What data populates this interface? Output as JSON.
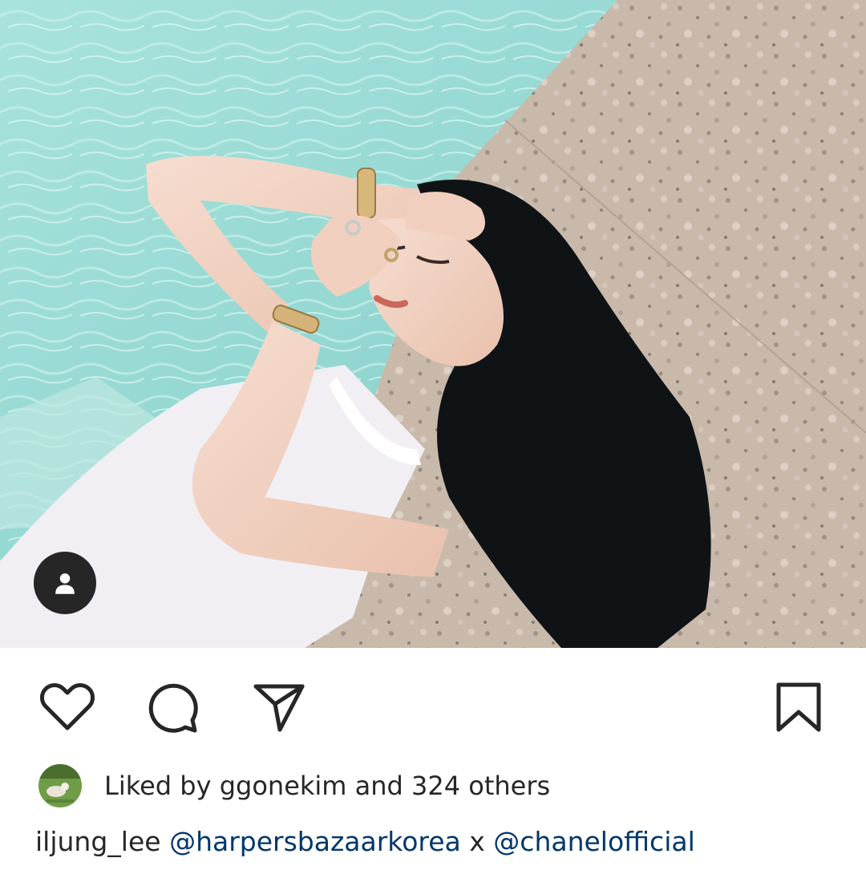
{
  "post": {
    "photo": {
      "alt": "",
      "tag_icon": "person-icon"
    },
    "actions": {
      "like_icon": "heart-icon",
      "comment_icon": "comment-icon",
      "share_icon": "paper-plane-icon",
      "save_icon": "bookmark-icon"
    },
    "likes": {
      "prefix": "Liked by ",
      "user": "ggonekim",
      "suffix": " and 324 others"
    },
    "caption": {
      "author": "iljung_lee",
      "mention_1": "@harpersbazaarkorea",
      "separator": " x ",
      "mention_2": "@chanelofficial"
    },
    "colors": {
      "text": "#262626",
      "mention": "#00376b",
      "pool": "#8fd6d0",
      "stone": "#c8b8ab"
    }
  }
}
